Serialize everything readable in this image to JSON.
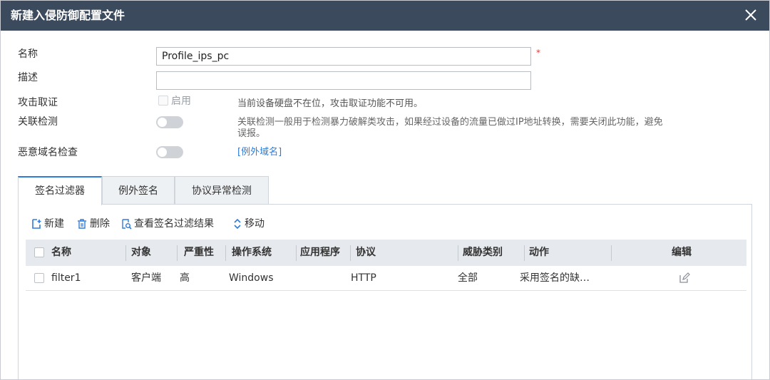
{
  "dialog": {
    "title": "新建入侵防御配置文件",
    "close_icon": "close-icon"
  },
  "form": {
    "name_label": "名称",
    "name_value": "Profile_ips_pc",
    "required_mark": "*",
    "desc_label": "描述",
    "desc_value": "",
    "forensics_label": "攻击取证",
    "forensics_checkbox_label": "启用",
    "forensics_checked": false,
    "forensics_hint": "当前设备硬盘不在位，攻击取证功能不可用。",
    "correlation_label": "关联检测",
    "correlation_on": false,
    "correlation_hint_line1": "关联检测一般用于检测暴力破解类攻击，如果经过设备的流量已做过IP地址转换，需要关闭此功能，避免",
    "correlation_hint_line2": "误报。",
    "malicious_domain_label": "恶意域名检查",
    "malicious_domain_on": false,
    "exception_domain_link": "[例外域名]"
  },
  "tabs": [
    {
      "label": "签名过滤器",
      "active": true
    },
    {
      "label": "例外签名",
      "active": false
    },
    {
      "label": "协议异常检测",
      "active": false
    }
  ],
  "toolbar": {
    "new_label": "新建",
    "delete_label": "删除",
    "view_result_label": "查看签名过滤结果",
    "move_label": "移动"
  },
  "table": {
    "headers": [
      "名称",
      "对象",
      "严重性",
      "操作系统",
      "应用程序",
      "协议",
      "威胁类别",
      "动作",
      "编辑"
    ],
    "rows": [
      {
        "name": "filter1",
        "object": "客户端",
        "severity": "高",
        "os": "Windows",
        "application": "",
        "protocol": "HTTP",
        "threat_category": "全部",
        "action": "采用签名的缺…",
        "edit_icon": "edit-icon"
      }
    ]
  },
  "colors": {
    "titlebar": "#3b4a5c",
    "link": "#2f7bd8",
    "required": "#e23b3b",
    "header_bg": "#e6e9ed"
  }
}
